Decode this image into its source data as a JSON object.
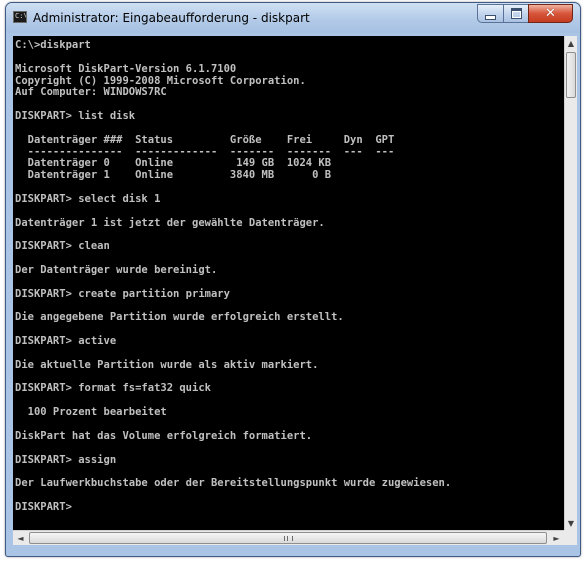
{
  "window": {
    "title": "Administrator: Eingabeaufforderung - diskpart",
    "icon": "cmd-icon",
    "buttons": {
      "minimize": "minimize-icon",
      "maximize": "maximize-icon",
      "close": "close-icon"
    }
  },
  "console": {
    "lines": [
      "C:\\>diskpart",
      "",
      "Microsoft DiskPart-Version 6.1.7100",
      "Copyright (C) 1999-2008 Microsoft Corporation.",
      "Auf Computer: WINDOWS7RC",
      "",
      "DISKPART> list disk",
      "",
      "  Datenträger ###  Status         Größe    Frei     Dyn  GPT",
      "  ---------------  -------------  -------  -------  ---  ---",
      "  Datenträger 0    Online          149 GB  1024 KB",
      "  Datenträger 1    Online         3840 MB      0 B",
      "",
      "DISKPART> select disk 1",
      "",
      "Datenträger 1 ist jetzt der gewählte Datenträger.",
      "",
      "DISKPART> clean",
      "",
      "Der Datenträger wurde bereinigt.",
      "",
      "DISKPART> create partition primary",
      "",
      "Die angegebene Partition wurde erfolgreich erstellt.",
      "",
      "DISKPART> active",
      "",
      "Die aktuelle Partition wurde als aktiv markiert.",
      "",
      "DISKPART> format fs=fat32 quick",
      "",
      "  100 Prozent bearbeitet",
      "",
      "DiskPart hat das Volume erfolgreich formatiert.",
      "",
      "DISKPART> assign",
      "",
      "Der Laufwerkbuchstabe oder der Bereitstellungspunkt wurde zugewiesen.",
      "",
      "DISKPART> "
    ]
  },
  "scrollbars": {
    "vertical": {
      "up": "▲",
      "down": "▼"
    },
    "horizontal": {
      "left": "◄",
      "right": "►",
      "grip": "|||"
    }
  }
}
